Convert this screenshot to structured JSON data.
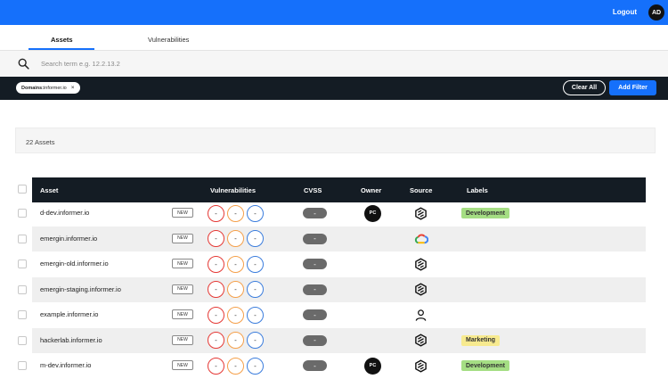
{
  "header": {
    "logout_label": "Logout",
    "avatar_initials": "AD",
    "brand_color": "#1570fb"
  },
  "tabs": [
    {
      "label": "Assets",
      "active": true
    },
    {
      "label": "Vulnerabilities",
      "active": false
    }
  ],
  "search": {
    "icon": "search-icon",
    "placeholder": "Search term e.g. 12.2.13.2",
    "value": ""
  },
  "filters": {
    "chip": {
      "key": "Domains:",
      "value": "informer.io",
      "close": "×"
    },
    "clear_all_label": "Clear All",
    "add_filter_label": "Add Filter"
  },
  "summary": {
    "count_text": "22 Assets"
  },
  "table": {
    "columns": [
      "Asset",
      "Vulnerabilities",
      "CVSS",
      "Owner",
      "Source",
      "Labels"
    ],
    "rows": [
      {
        "asset": "d-dev.informer.io",
        "badge": "NEW",
        "vulns": [
          "-",
          "-",
          "-"
        ],
        "cvss": "-",
        "owner": "PC",
        "source": "hexagon-icon",
        "label": "Development",
        "label_color": "#a5de84"
      },
      {
        "asset": "emergin.informer.io",
        "badge": "NEW",
        "vulns": [
          "-",
          "-",
          "-"
        ],
        "cvss": "-",
        "owner": "",
        "source": "google-cloud-icon",
        "label": "",
        "label_color": ""
      },
      {
        "asset": "emergin-old.informer.io",
        "badge": "NEW",
        "vulns": [
          "-",
          "-",
          "-"
        ],
        "cvss": "-",
        "owner": "",
        "source": "hexagon-icon",
        "label": "",
        "label_color": ""
      },
      {
        "asset": "emergin-staging.informer.io",
        "badge": "NEW",
        "vulns": [
          "-",
          "-",
          "-"
        ],
        "cvss": "-",
        "owner": "",
        "source": "hexagon-icon",
        "label": "",
        "label_color": ""
      },
      {
        "asset": "example.informer.io",
        "badge": "NEW",
        "vulns": [
          "-",
          "-",
          "-"
        ],
        "cvss": "-",
        "owner": "",
        "source": "user-icon",
        "label": "",
        "label_color": ""
      },
      {
        "asset": "hackerlab.informer.io",
        "badge": "NEW",
        "vulns": [
          "-",
          "-",
          "-"
        ],
        "cvss": "-",
        "owner": "",
        "source": "hexagon-icon",
        "label": "Marketing",
        "label_color": "#f7ea8f"
      },
      {
        "asset": "m-dev.informer.io",
        "badge": "NEW",
        "vulns": [
          "-",
          "-",
          "-"
        ],
        "cvss": "-",
        "owner": "PC",
        "source": "hexagon-icon",
        "label": "Development",
        "label_color": "#a5de84"
      }
    ]
  }
}
